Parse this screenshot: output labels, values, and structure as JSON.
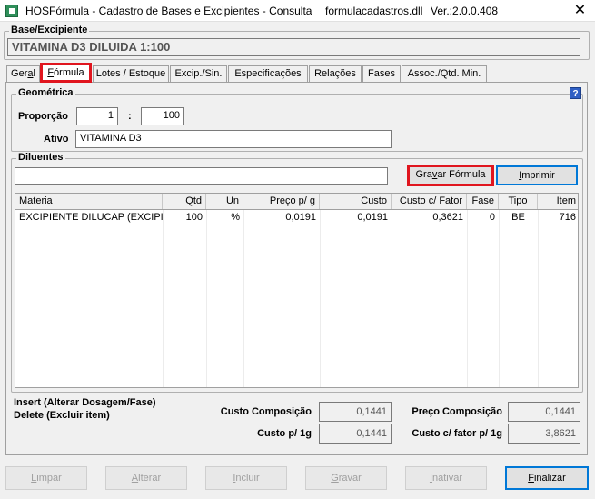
{
  "window": {
    "title": "HOSFórmula - Cadastro de Bases e Excipientes - Consulta",
    "dll": "formulacadastros.dll",
    "version": "Ver.:2.0.0.408",
    "close": "✕"
  },
  "base": {
    "label": "Base/Excipiente",
    "value": "VITAMINA D3 DILUIDA 1:100"
  },
  "tabs": [
    {
      "label": "Geral",
      "u": "a"
    },
    {
      "label": "Fórmula",
      "u": "F"
    },
    {
      "label": "Lotes / Estoque"
    },
    {
      "label": "Excip./Sin."
    },
    {
      "label": "Especificações"
    },
    {
      "label": "Relações"
    },
    {
      "label": "Fases"
    },
    {
      "label": "Assoc./Qtd. Min."
    }
  ],
  "geometrica": {
    "label": "Geométrica",
    "proporcao_label": "Proporção",
    "proporcao_a": "1",
    "separator": ":",
    "proporcao_b": "100",
    "ativo_label": "Ativo",
    "ativo_value": "VITAMINA D3",
    "help": "?"
  },
  "diluentes": {
    "label": "Diluentes",
    "search_value": "",
    "gravar_formula": "Gravar Fórmula",
    "imprimir": "Imprimir"
  },
  "table": {
    "columns": [
      "Materia",
      "Qtd",
      "Un",
      "Preço p/ g",
      "Custo",
      "Custo c/ Fator",
      "Fase",
      "Tipo",
      "Item"
    ],
    "rows": [
      [
        "EXCIPIENTE DILUCAP (EXCIPIE...",
        "100",
        "%",
        "0,0191",
        "0,0191",
        "0,3621",
        "0",
        "BE",
        "716"
      ]
    ]
  },
  "hints": {
    "insert": "Insert (Alterar Dosagem/Fase)",
    "delete": "Delete (Excluir item)"
  },
  "totals": {
    "custo_composicao_label": "Custo Composição",
    "custo_composicao": "0,1441",
    "preco_composicao_label": "Preço Composição",
    "preco_composicao": "0,1441",
    "custo_1g_label": "Custo p/ 1g",
    "custo_1g": "0,1441",
    "custo_fator_1g_label": "Custo c/ fator p/ 1g",
    "custo_fator_1g": "3,8621"
  },
  "buttons": {
    "limpar": "Limpar",
    "alterar": "Alterar",
    "incluir": "Incluir",
    "gravar": "Gravar",
    "inativar": "Inativar",
    "finalizar": "Finalizar"
  }
}
